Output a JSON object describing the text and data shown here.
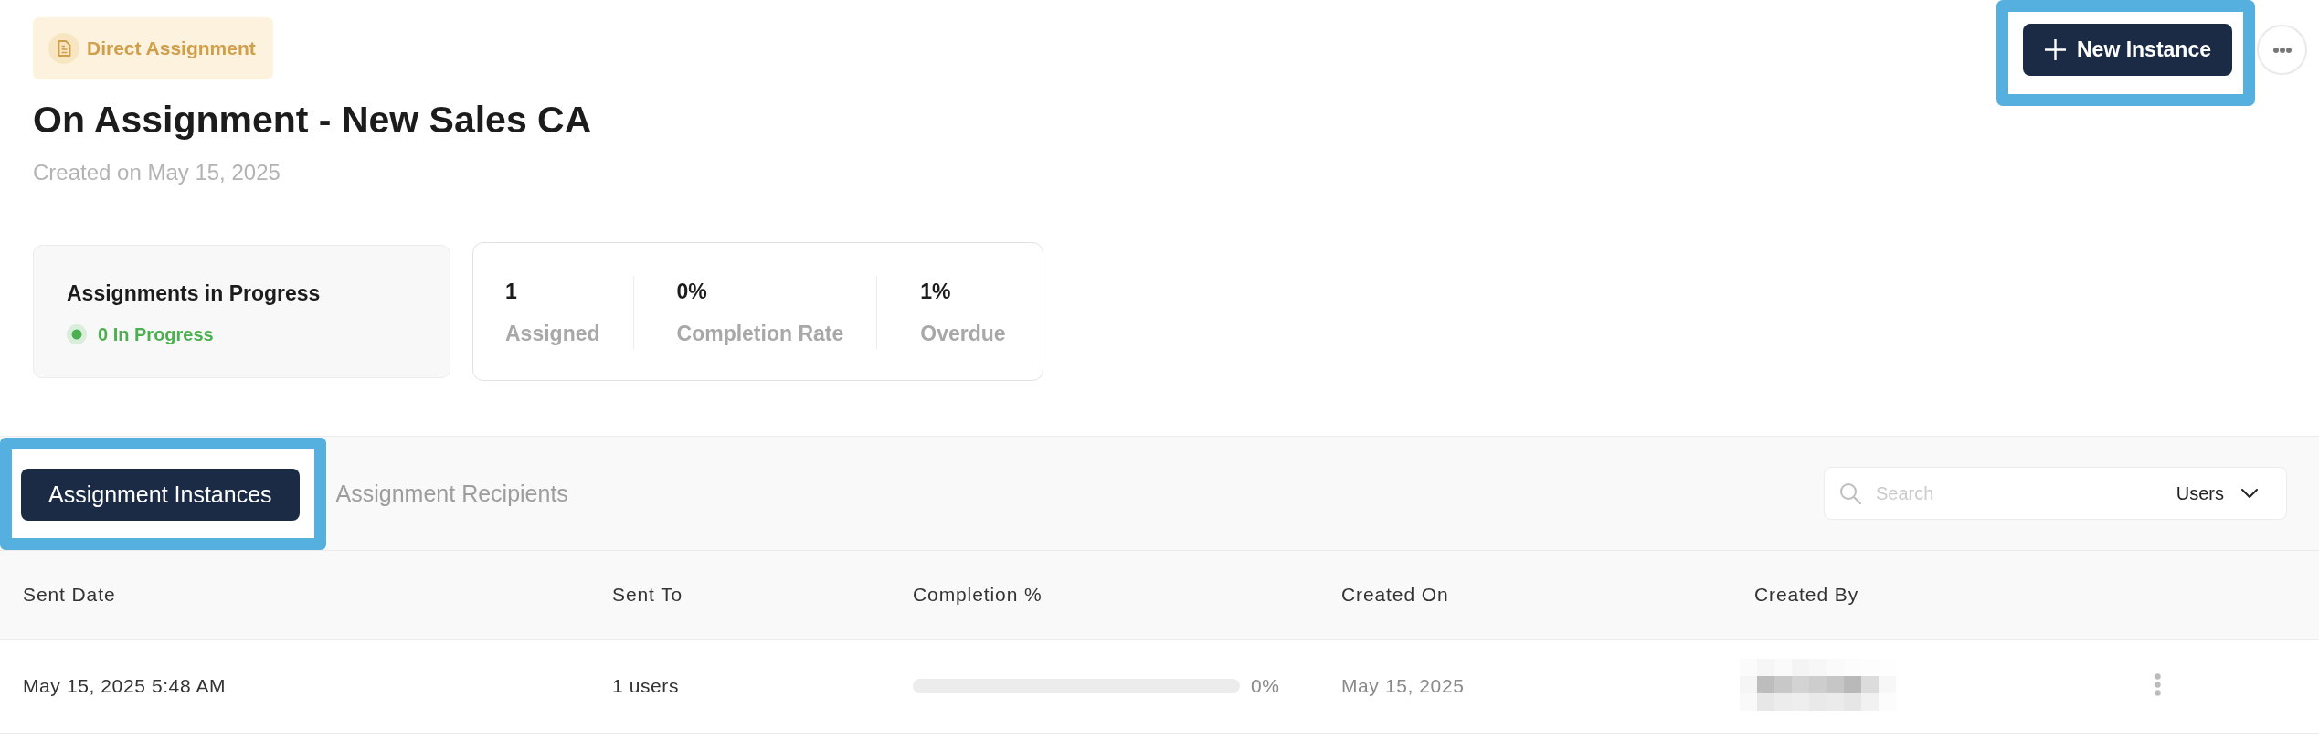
{
  "header": {
    "badge": "Direct Assignment",
    "title": "On Assignment - New Sales CA",
    "subtitle": "Created on May 15, 2025"
  },
  "actions": {
    "new_instance": {
      "label": "New Instance",
      "highlighted": true
    }
  },
  "summary": {
    "progress": {
      "title": "Assignments in Progress",
      "status": "0 In Progress"
    },
    "stats": [
      {
        "value": "1",
        "label": "Assigned"
      },
      {
        "value": "0%",
        "label": "Completion Rate"
      },
      {
        "value": "1%",
        "label": "Overdue"
      }
    ]
  },
  "tabs": [
    {
      "label": "Assignment Instances",
      "selected": true,
      "highlighted": true
    },
    {
      "label": "Assignment Recipients",
      "selected": false,
      "highlighted": false
    }
  ],
  "search": {
    "placeholder": "Search",
    "filter": "Users"
  },
  "table": {
    "columns": [
      "Sent Date",
      "Sent To",
      "Completion %",
      "Created On",
      "Created By"
    ],
    "rows": [
      {
        "sent_date": "May 15, 2025 5:48 AM",
        "sent_to": "1 users",
        "completion": {
          "level": 0,
          "reading": "0%"
        },
        "created_on": "May 15, 2025",
        "created_by_redacted": true
      }
    ]
  }
}
